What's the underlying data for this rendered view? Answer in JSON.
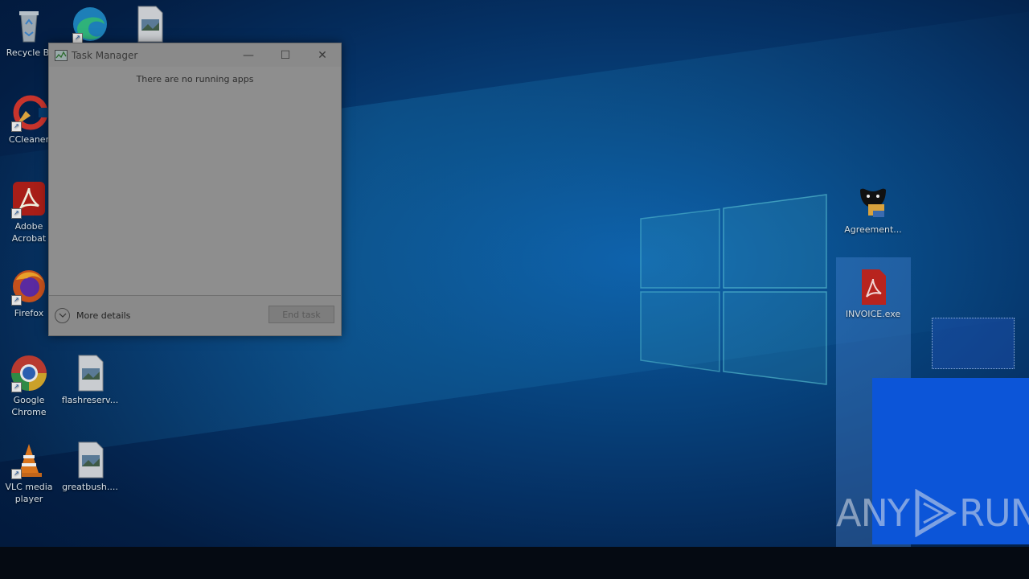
{
  "desktop": {
    "icons": [
      {
        "label": "Recycle Bin",
        "display": "Recycle Bi"
      },
      {
        "label": "CCleaner",
        "display": "CCleaner"
      },
      {
        "label": "Adobe Acrobat",
        "display": "Adobe Acrobat"
      },
      {
        "label": "Firefox",
        "display": "Firefox"
      },
      {
        "label": "Google Chrome",
        "display": "Google Chrome"
      },
      {
        "label": "VLC media player",
        "display": "VLC media player"
      },
      {
        "label": "Microsoft Edge",
        "display": ""
      },
      {
        "label": "image file",
        "display": ""
      },
      {
        "label": "flashreserv...",
        "display": "flashreserv..."
      },
      {
        "label": "greatbush....",
        "display": "greatbush...."
      },
      {
        "label": "Agreement...",
        "display": "Agreement..."
      },
      {
        "label": "INVOICE.exe",
        "display": "INVOICE.exe"
      }
    ]
  },
  "task_manager": {
    "title": "Task Manager",
    "empty_message": "There are no running apps",
    "more_details_label": "More details",
    "end_task_label": "End task"
  },
  "watermark": {
    "left": "ANY",
    "right": "RUN"
  }
}
